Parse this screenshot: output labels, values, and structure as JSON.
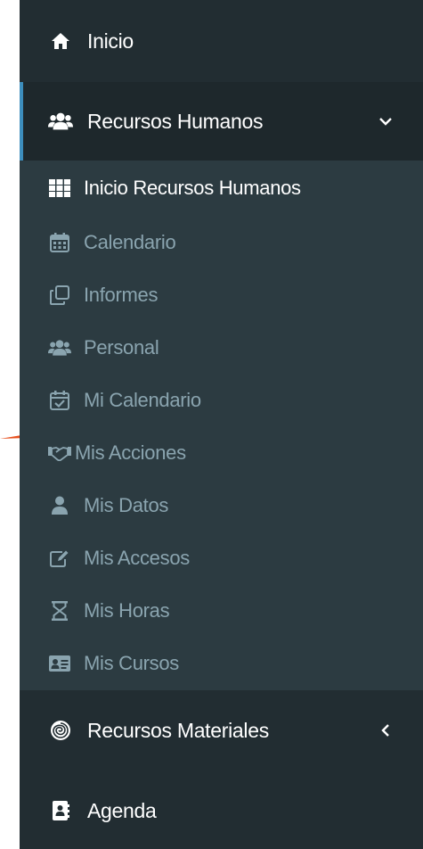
{
  "sidebar": {
    "items": [
      {
        "label": "Inicio",
        "icon": "home-icon"
      },
      {
        "label": "Recursos Humanos",
        "icon": "users-icon",
        "expanded": true,
        "children": [
          {
            "label": "Inicio Recursos Humanos",
            "icon": "grid-icon",
            "current": true
          },
          {
            "label": "Calendario",
            "icon": "calendar-icon"
          },
          {
            "label": "Informes",
            "icon": "copy-icon"
          },
          {
            "label": "Personal",
            "icon": "users-icon"
          },
          {
            "label": "Mi Calendario",
            "icon": "calendar-check-icon"
          },
          {
            "label": "Mis Acciones",
            "icon": "handshake-icon"
          },
          {
            "label": "Mis Datos",
            "icon": "user-icon"
          },
          {
            "label": "Mis Accesos",
            "icon": "edit-icon"
          },
          {
            "label": "Mis Horas",
            "icon": "hourglass-icon"
          },
          {
            "label": "Mis Cursos",
            "icon": "id-card-icon"
          }
        ]
      },
      {
        "label": "Recursos Materiales",
        "icon": "spiral-icon",
        "expanded": false
      },
      {
        "label": "Agenda",
        "icon": "address-book-icon"
      }
    ]
  },
  "colors": {
    "sidebar_bg": "#222d32",
    "active_bg": "#1e282c",
    "submenu_bg": "#2c3b41",
    "accent": "#3c8dbc",
    "submenu_text": "#8aa4af",
    "arrow": "#e8501e"
  }
}
